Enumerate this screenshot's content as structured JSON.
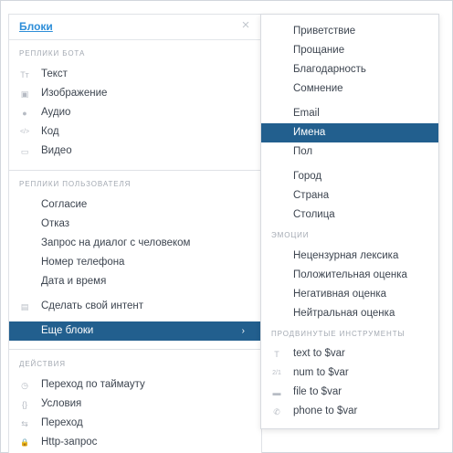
{
  "panel": {
    "title": "Блоки",
    "close": "×"
  },
  "sections": {
    "bot": "Реплики бота",
    "user": "Реплики пользователя",
    "actions": "Действия"
  },
  "bot_items": [
    {
      "label": "Текст",
      "icon": "Tт"
    },
    {
      "label": "Изображение",
      "icon": "▣"
    },
    {
      "label": "Аудио",
      "icon": "●"
    },
    {
      "label": "Код",
      "icon": "</>"
    },
    {
      "label": "Видео",
      "icon": "▭"
    }
  ],
  "user_items": [
    {
      "label": "Согласие"
    },
    {
      "label": "Отказ"
    },
    {
      "label": "Запрос на диалог с человеком"
    },
    {
      "label": "Номер телефона"
    },
    {
      "label": "Дата и время"
    }
  ],
  "intent": {
    "label": "Сделать свой интент",
    "icon": "▤"
  },
  "more": {
    "label": "Еще блоки",
    "chevron": "›"
  },
  "action_items": [
    {
      "label": "Переход по таймауту",
      "icon": "◷"
    },
    {
      "label": "Условия",
      "icon": "{}"
    },
    {
      "label": "Переход",
      "icon": "⇆"
    },
    {
      "label": "Http-запрос",
      "icon": "🔒"
    }
  ],
  "dropdown": {
    "group1": [
      "Приветствие",
      "Прощание",
      "Благодарность",
      "Сомнение"
    ],
    "group2": [
      "Email",
      "Имена",
      "Пол"
    ],
    "group3": [
      "Город",
      "Страна",
      "Столица"
    ],
    "emotions_label": "Эмоции",
    "emotions": [
      "Нецензурная лексика",
      "Положительная оценка",
      "Негативная оценка",
      "Нейтральная оценка"
    ],
    "advanced_label": "Продвинутые инструменты",
    "advanced": [
      {
        "label": "text to $var",
        "icon": "T"
      },
      {
        "label": "num to $var",
        "icon": "2/1"
      },
      {
        "label": "file to $var",
        "icon": "▬"
      },
      {
        "label": "phone to $var",
        "icon": "✆"
      }
    ],
    "active": "Имена"
  }
}
